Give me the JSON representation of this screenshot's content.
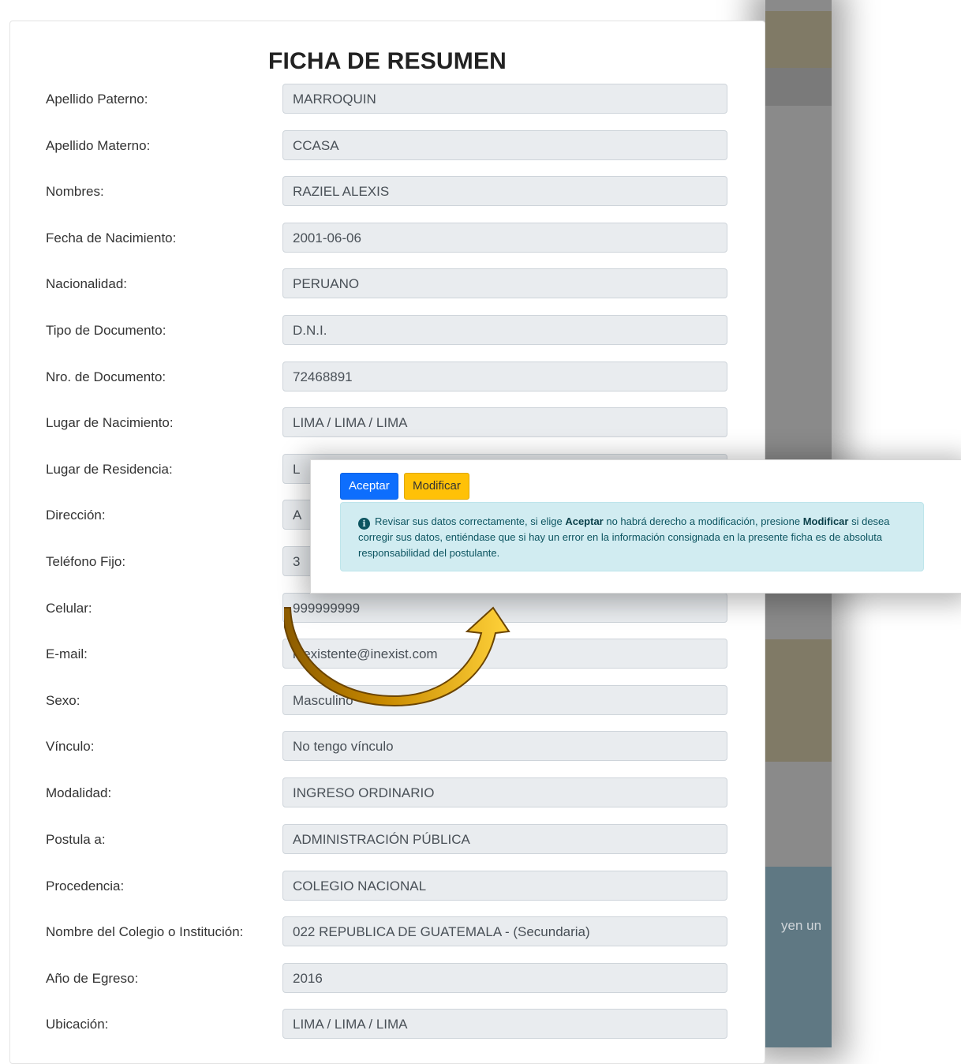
{
  "summary": {
    "title": "FICHA DE RESUMEN",
    "fields": [
      {
        "label": "Apellido Paterno:",
        "value": "MARROQUIN"
      },
      {
        "label": "Apellido Materno:",
        "value": "CCASA"
      },
      {
        "label": "Nombres:",
        "value": "RAZIEL ALEXIS"
      },
      {
        "label": "Fecha de Nacimiento:",
        "value": "2001-06-06"
      },
      {
        "label": "Nacionalidad:",
        "value": "PERUANO"
      },
      {
        "label": "Tipo de Documento:",
        "value": "D.N.I."
      },
      {
        "label": "Nro. de Documento:",
        "value": "72468891"
      },
      {
        "label": "Lugar de Nacimiento:",
        "value": "LIMA / LIMA / LIMA"
      },
      {
        "label": "Lugar de Residencia:",
        "value": "L"
      },
      {
        "label": "Dirección:",
        "value": "A"
      },
      {
        "label": "Teléfono Fijo:",
        "value": "3"
      },
      {
        "label": "Celular:",
        "value": "999999999"
      },
      {
        "label": "E-mail:",
        "value": "inexistente@inexist.com"
      },
      {
        "label": "Sexo:",
        "value": "Masculino"
      },
      {
        "label": "Vínculo:",
        "value": "No tengo vínculo"
      },
      {
        "label": "Modalidad:",
        "value": "INGRESO ORDINARIO"
      },
      {
        "label": "Postula a:",
        "value": "ADMINISTRACIÓN PÚBLICA"
      },
      {
        "label": "Procedencia:",
        "value": "COLEGIO NACIONAL"
      },
      {
        "label": "Nombre del Colegio o Institución:",
        "value": "022 REPUBLICA DE GUATEMALA - (Secundaria)"
      },
      {
        "label": "Año de Egreso:",
        "value": "2016"
      },
      {
        "label": "Ubicación:",
        "value": "LIMA / LIMA / LIMA"
      }
    ]
  },
  "dialog": {
    "accept_label": "Aceptar",
    "modify_label": "Modificar",
    "alert": {
      "icon": "info-icon",
      "part1": "Revisar sus datos correctamente, si elige ",
      "bold1": "Aceptar",
      "part2": " no habrá derecho a modificación, presione ",
      "bold2": "Modificar",
      "part3": " si desea corregir sus datos, entiéndase que si hay un error en la información consignada en la presente ficha es de absoluta responsabilidad del postulante."
    }
  },
  "background": {
    "partial_text": "yen un"
  },
  "colors": {
    "accept": "#0d6efd",
    "modify": "#ffc107",
    "alert_bg": "#d1ecf1",
    "arrow": "#f0b400"
  }
}
